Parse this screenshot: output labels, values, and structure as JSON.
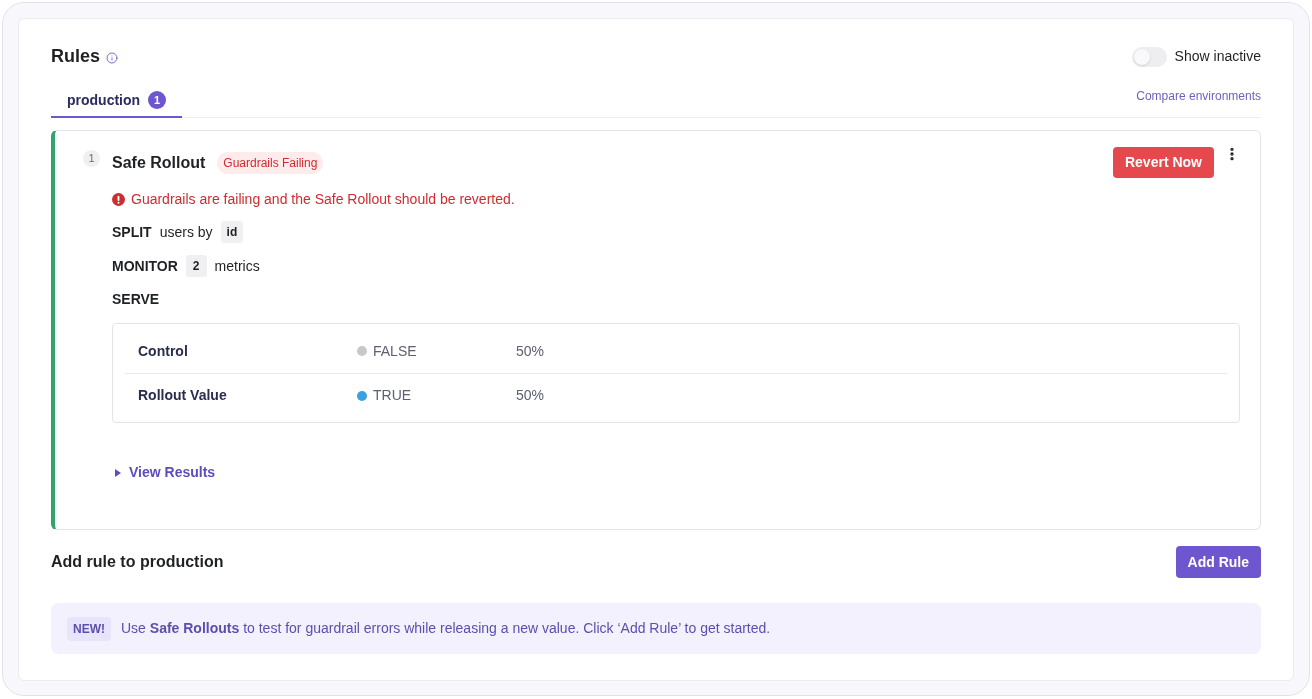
{
  "header": {
    "title": "Rules",
    "show_inactive": {
      "label": "Show inactive",
      "on": false
    }
  },
  "tabs": [
    {
      "label": "production",
      "count": "1",
      "selected": true
    }
  ],
  "compare_link": "Compare environments",
  "rules": [
    {
      "number": "1",
      "title": "Safe Rollout",
      "status_badge": "Guardrails Failing",
      "action_button": "Revert Now",
      "alert": "Guardrails are failing and the Safe Rollout should be reverted.",
      "split": {
        "keyword": "SPLIT",
        "text": "users by",
        "attribute": "id"
      },
      "monitor": {
        "keyword": "MONITOR",
        "count": "2",
        "text": "metrics"
      },
      "serve": {
        "keyword": "SERVE",
        "rows": [
          {
            "name": "Control",
            "value": "FALSE",
            "color": "#c8c8c8",
            "percent": "50%"
          },
          {
            "name": "Rollout Value",
            "value": "TRUE",
            "color": "#3ba0e0",
            "percent": "50%"
          }
        ]
      },
      "view_results": {
        "label": "View Results",
        "expanded": false
      }
    }
  ],
  "add_rule": {
    "title": "Add rule to production",
    "button": "Add Rule"
  },
  "banner": {
    "badge": "NEW!",
    "text": "Use **Safe Rollouts** to test for guardrail errors while releasing a new value. Click ‘Add Rule’ to get started."
  }
}
